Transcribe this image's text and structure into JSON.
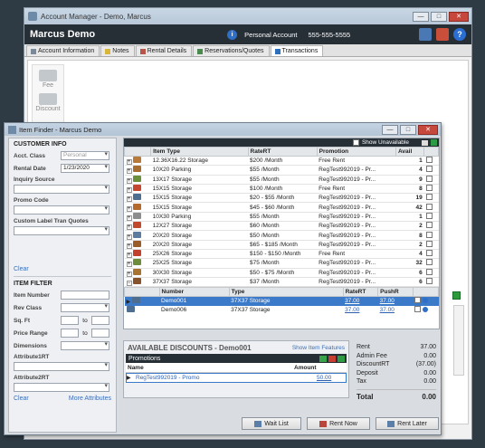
{
  "account_manager": {
    "title": "Account Manager - Demo, Marcus",
    "customer_name": "Marcus Demo",
    "account_label": "Personal Account",
    "phone": "555-555-5555",
    "tabs": [
      "Account Information",
      "Notes",
      "Rental Details",
      "Reservations/Quotes",
      "Transactions"
    ],
    "sidebar": [
      "Fee",
      "Discount"
    ]
  },
  "item_finder": {
    "title": "Item Finder - Marcus Demo",
    "customer_info": {
      "heading": "CUSTOMER INFO",
      "acct_class_label": "Acct. Class",
      "acct_class_value": "Personal",
      "rental_date_label": "Rental Date",
      "rental_date_value": "1/23/2020",
      "inquiry_source_label": "Inquiry Source",
      "promo_code_label": "Promo Code",
      "custom_label": "Custom Label Tran Quotes",
      "clear": "Clear"
    },
    "item_filter": {
      "heading": "ITEM FILTER",
      "item_number_label": "Item Number",
      "rev_class_label": "Rev Class",
      "sq_ft_label": "Sq. Ft",
      "to": "to",
      "price_range_label": "Price Range",
      "dimensions_label": "Dimensions",
      "attribute1_label": "Attribute1RT",
      "attribute2_label": "Attribute2RT",
      "clear": "Clear",
      "more": "More Attributes"
    },
    "grid": {
      "show_unavailable": "Show Unavailable",
      "headers": [
        "Item Type",
        "RateRT",
        "Promotion",
        "Avail"
      ],
      "rows": [
        {
          "type": "12.36X16.22  Storage",
          "rate": "$200 /Month",
          "promo": "Free Rent",
          "avail": "1",
          "color": "#b77a3b"
        },
        {
          "type": "10X20  Parking",
          "rate": "$55 /Month",
          "promo": "RegTest992019 - Pr...",
          "avail": "4",
          "color": "#a86d30"
        },
        {
          "type": "13X17  Storage",
          "rate": "$55 /Month",
          "promo": "RegTest992019 - Pr...",
          "avail": "9",
          "color": "#6b8f3a"
        },
        {
          "type": "15X15  Storage",
          "rate": "$100 /Month",
          "promo": "Free Rent",
          "avail": "8",
          "color": "#c7462f"
        },
        {
          "type": "15X15  Storage",
          "rate": "$20 - $55 /Month",
          "promo": "RegTest992019 - Pr...",
          "avail": "19",
          "color": "#4d6e91"
        },
        {
          "type": "15X15  Storage",
          "rate": "$45 - $60 /Month",
          "promo": "RegTest992019 - Pr...",
          "avail": "42",
          "color": "#b36a2c"
        },
        {
          "type": "10X30  Parking",
          "rate": "$55 /Month",
          "promo": "RegTest992019 - Pr...",
          "avail": "1",
          "color": "#8d8d8d"
        },
        {
          "type": "12X27  Storage",
          "rate": "$60 /Month",
          "promo": "RegTest992019 - Pr...",
          "avail": "2",
          "color": "#c14a2e"
        },
        {
          "type": "20X20  Storage",
          "rate": "$50 /Month",
          "promo": "RegTest992019 - Pr...",
          "avail": "8",
          "color": "#5b7c9e"
        },
        {
          "type": "20X20  Storage",
          "rate": "$65 - $185 /Month",
          "promo": "RegTest992019 - Pr...",
          "avail": "2",
          "color": "#9a5d2a"
        },
        {
          "type": "25X26  Storage",
          "rate": "$150 - $150 /Month",
          "promo": "Free Rent",
          "avail": "4",
          "color": "#c2402e"
        },
        {
          "type": "25X25  Storage",
          "rate": "$75 /Month",
          "promo": "RegTest992019 - Pr...",
          "avail": "32",
          "color": "#6d8c3c"
        },
        {
          "type": "30X30  Storage",
          "rate": "$50 - $75 /Month",
          "promo": "RegTest992019 - Pr...",
          "avail": "6",
          "color": "#a97332"
        },
        {
          "type": "37X37  Storage",
          "rate": "$37 /Month",
          "promo": "RegTest992019 - Pr...",
          "avail": "6",
          "color": "#86522c"
        }
      ],
      "sub_headers": [
        "Number",
        "Type",
        "RateRT",
        "PushR"
      ],
      "sub_rows": [
        {
          "number": "Demo001",
          "type": "37X37  Storage",
          "rate": "37.00",
          "push": "37.00"
        },
        {
          "number": "Demo006",
          "type": "37X37  Storage",
          "rate": "37.00",
          "push": "37.00"
        }
      ]
    },
    "discounts": {
      "title": "AVAILABLE DISCOUNTS - Demo001",
      "features": "Show Item Features",
      "promotions_label": "Promotions",
      "col_name": "Name",
      "col_amount": "Amount",
      "promo_name": "RegTest992019 - Promo",
      "promo_amount": "50.00"
    },
    "totals": {
      "rows": [
        {
          "label": "Rent",
          "value": "37.00"
        },
        {
          "label": "Admin Fee",
          "value": "0.00"
        },
        {
          "label": "DiscountRT",
          "value": "(37.00)"
        },
        {
          "label": "Deposit",
          "value": "0.00"
        },
        {
          "label": "Tax",
          "value": "0.00"
        }
      ],
      "total_label": "Total",
      "total_value": "0.00"
    },
    "buttons": {
      "wait_list": "Wait List",
      "rent_now": "Rent Now",
      "rent_later": "Rent Later"
    }
  }
}
